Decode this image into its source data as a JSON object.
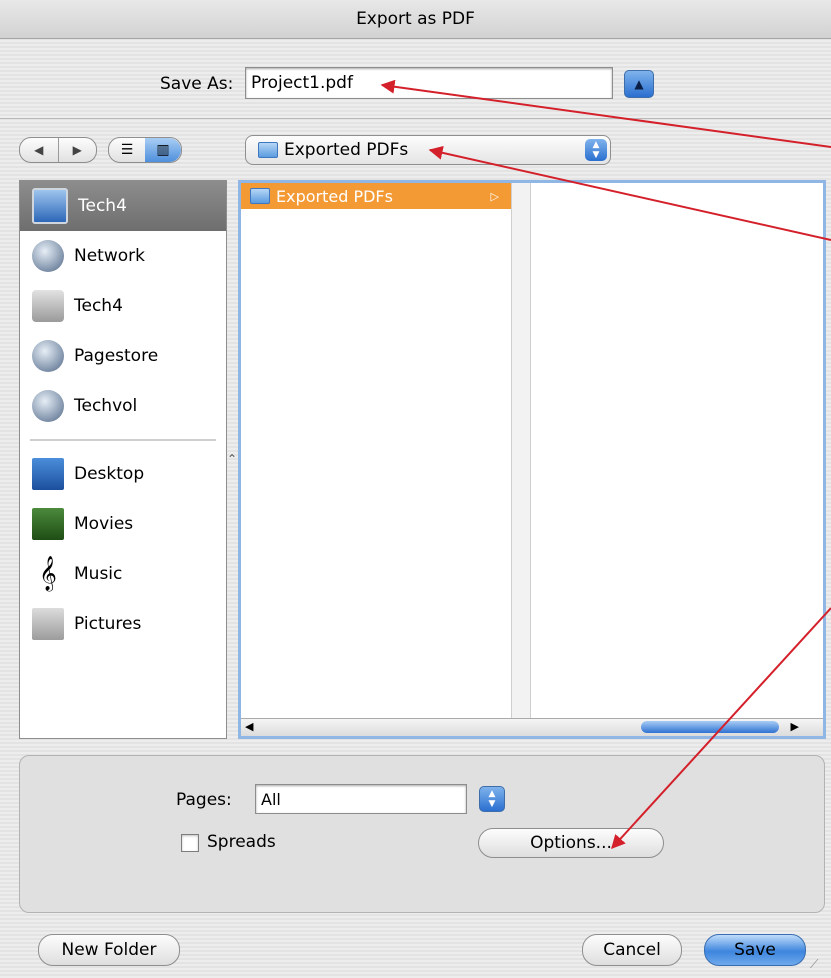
{
  "window": {
    "title": "Export as PDF"
  },
  "save_as": {
    "label": "Save As:",
    "value": "Project1.pdf",
    "expand_icon": "expand-triangle-icon"
  },
  "navigation": {
    "back_icon": "◀",
    "forward_icon": "▶",
    "list_view_icon": "☰",
    "column_view_icon": "▥"
  },
  "location": {
    "value": "Exported PDFs",
    "arrows_up": "▲",
    "arrows_down": "▼"
  },
  "sidebar": {
    "devices": [
      {
        "label": "Tech4",
        "icon": "monitor-icon",
        "selected": true
      },
      {
        "label": "Network",
        "icon": "network-icon",
        "selected": false
      },
      {
        "label": "Tech4",
        "icon": "hard-disk-icon",
        "selected": false
      },
      {
        "label": "Pagestore",
        "icon": "server-volume-icon",
        "selected": false
      },
      {
        "label": "Techvol",
        "icon": "server-volume-icon",
        "selected": false
      }
    ],
    "places": [
      {
        "label": "Desktop",
        "icon": "desktop-icon"
      },
      {
        "label": "Movies",
        "icon": "movies-icon"
      },
      {
        "label": "Music",
        "icon": "music-icon",
        "glyph": "𝄞"
      },
      {
        "label": "Pictures",
        "icon": "pictures-icon"
      }
    ]
  },
  "browser": {
    "column1": [
      {
        "label": "Exported PDFs",
        "selected": true,
        "has_children": "▷"
      }
    ],
    "scroll_left": "◀",
    "scroll_right": "▶"
  },
  "options": {
    "pages_label": "Pages:",
    "pages_value": "All",
    "spreads_label": "Spreads",
    "spreads_checked": false,
    "options_button": "Options..."
  },
  "footer": {
    "new_folder": "New Folder",
    "cancel": "Cancel",
    "save": "Save"
  },
  "colors": {
    "selection": "#f39a35",
    "accent_blue": "#2a6fd0",
    "annotation_arrow": "#d4202a"
  }
}
